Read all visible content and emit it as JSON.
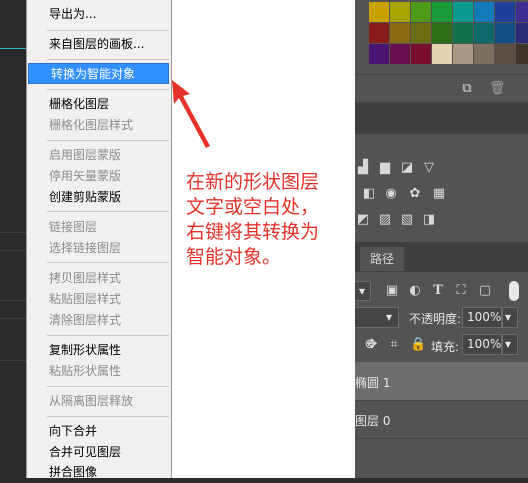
{
  "context_menu": {
    "items": [
      {
        "label": "导出为...",
        "enabled": true
      },
      {
        "label": "来自图层的画板...",
        "enabled": true
      },
      {
        "label": "转换为智能对象",
        "enabled": true,
        "selected": true
      },
      {
        "label": "栅格化图层",
        "enabled": true
      },
      {
        "label": "栅格化图层样式",
        "enabled": false
      },
      {
        "label": "启用图层蒙版",
        "enabled": false
      },
      {
        "label": "停用矢量蒙版",
        "enabled": false
      },
      {
        "label": "创建剪贴蒙版",
        "enabled": true
      },
      {
        "label": "链接图层",
        "enabled": false
      },
      {
        "label": "选择链接图层",
        "enabled": false
      },
      {
        "label": "拷贝图层样式",
        "enabled": false
      },
      {
        "label": "粘贴图层样式",
        "enabled": false
      },
      {
        "label": "清除图层样式",
        "enabled": false
      },
      {
        "label": "复制形状属性",
        "enabled": true
      },
      {
        "label": "粘贴形状属性",
        "enabled": false
      },
      {
        "label": "从隔离图层释放",
        "enabled": false
      },
      {
        "label": "向下合并",
        "enabled": true
      },
      {
        "label": "合并可见图层",
        "enabled": true
      },
      {
        "label": "拼合图像",
        "enabled": true
      }
    ]
  },
  "annotation": {
    "lines": [
      "在新的形状图层",
      "文字或空白处，",
      "右键将其转换为",
      "智能对象。"
    ],
    "color": "#e53329"
  },
  "layers_panel": {
    "tab_paths": "路径",
    "opacity_label": "不透明度:",
    "opacity_value": "100%",
    "fill_label": "填充:",
    "fill_value": "100%",
    "layers": [
      {
        "name": "椭圆 1"
      },
      {
        "name": "图层 0"
      }
    ]
  },
  "colors": {
    "menu_highlight": "#3390ff",
    "panel_bg": "#535353"
  }
}
